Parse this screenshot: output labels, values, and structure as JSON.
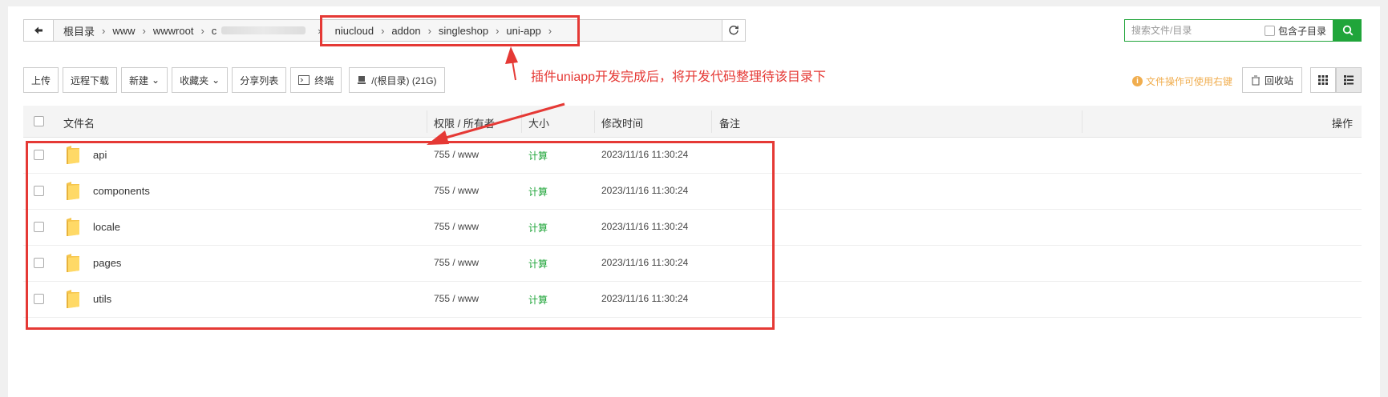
{
  "path": {
    "crumbs_before": [
      "根目录",
      "www",
      "wwwroot",
      "c"
    ],
    "crumbs_highlight": [
      "niucloud",
      "addon",
      "singleshop",
      "uni-app"
    ]
  },
  "search": {
    "placeholder": "搜索文件/目录",
    "include_sub_label": "包含子目录"
  },
  "toolbar": {
    "upload": "上传",
    "remote_download": "远程下载",
    "new": "新建",
    "favorites": "收藏夹",
    "share_list": "分享列表",
    "terminal": "终端",
    "disk": "/(根目录) (21G)"
  },
  "hint": "文件操作可使用右键",
  "recycle_bin": "回收站",
  "table": {
    "headers": {
      "name": "文件名",
      "perm": "权限 / 所有者",
      "size": "大小",
      "mtime": "修改时间",
      "remark": "备注",
      "ops": "操作"
    },
    "rows": [
      {
        "name": "api",
        "perm": "755 / www",
        "size": "计算",
        "mtime": "2023/11/16 11:30:24"
      },
      {
        "name": "components",
        "perm": "755 / www",
        "size": "计算",
        "mtime": "2023/11/16 11:30:24"
      },
      {
        "name": "locale",
        "perm": "755 / www",
        "size": "计算",
        "mtime": "2023/11/16 11:30:24"
      },
      {
        "name": "pages",
        "perm": "755 / www",
        "size": "计算",
        "mtime": "2023/11/16 11:30:24"
      },
      {
        "name": "utils",
        "perm": "755 / www",
        "size": "计算",
        "mtime": "2023/11/16 11:30:24"
      }
    ]
  },
  "annotation": {
    "text": "插件uniapp开发完成后，将开发代码整理待该目录下",
    "color": "#e53935"
  },
  "colors": {
    "accent": "#20a53a",
    "hint": "#f0ad4e",
    "annotation": "#e53935"
  }
}
